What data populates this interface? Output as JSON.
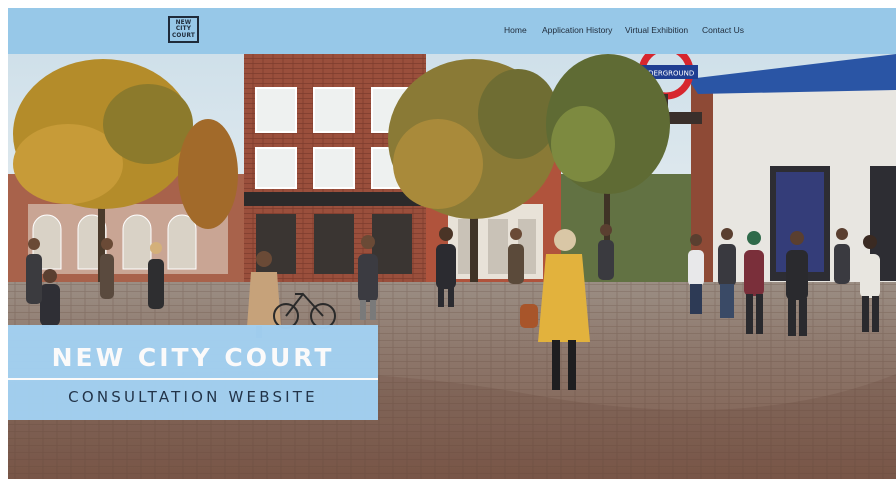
{
  "header": {
    "logo": {
      "line1": "NEW",
      "line2": "CITY",
      "line3": "COURT"
    },
    "nav": [
      {
        "label": "Home"
      },
      {
        "label": "Application History"
      },
      {
        "label": "Virtual Exhibition"
      },
      {
        "label": "Contact Us"
      }
    ]
  },
  "hero": {
    "sign_text": "UNDERGROUND",
    "title": "NEW CITY COURT",
    "subtitle": "CONSULTATION WEBSITE"
  },
  "colors": {
    "header_bg": "#97c8e8",
    "banner_bg": "#a3d1f2",
    "nav_text": "#1f2b3a",
    "banner_title": "#ffffff",
    "banner_subtitle": "#1f3248"
  }
}
